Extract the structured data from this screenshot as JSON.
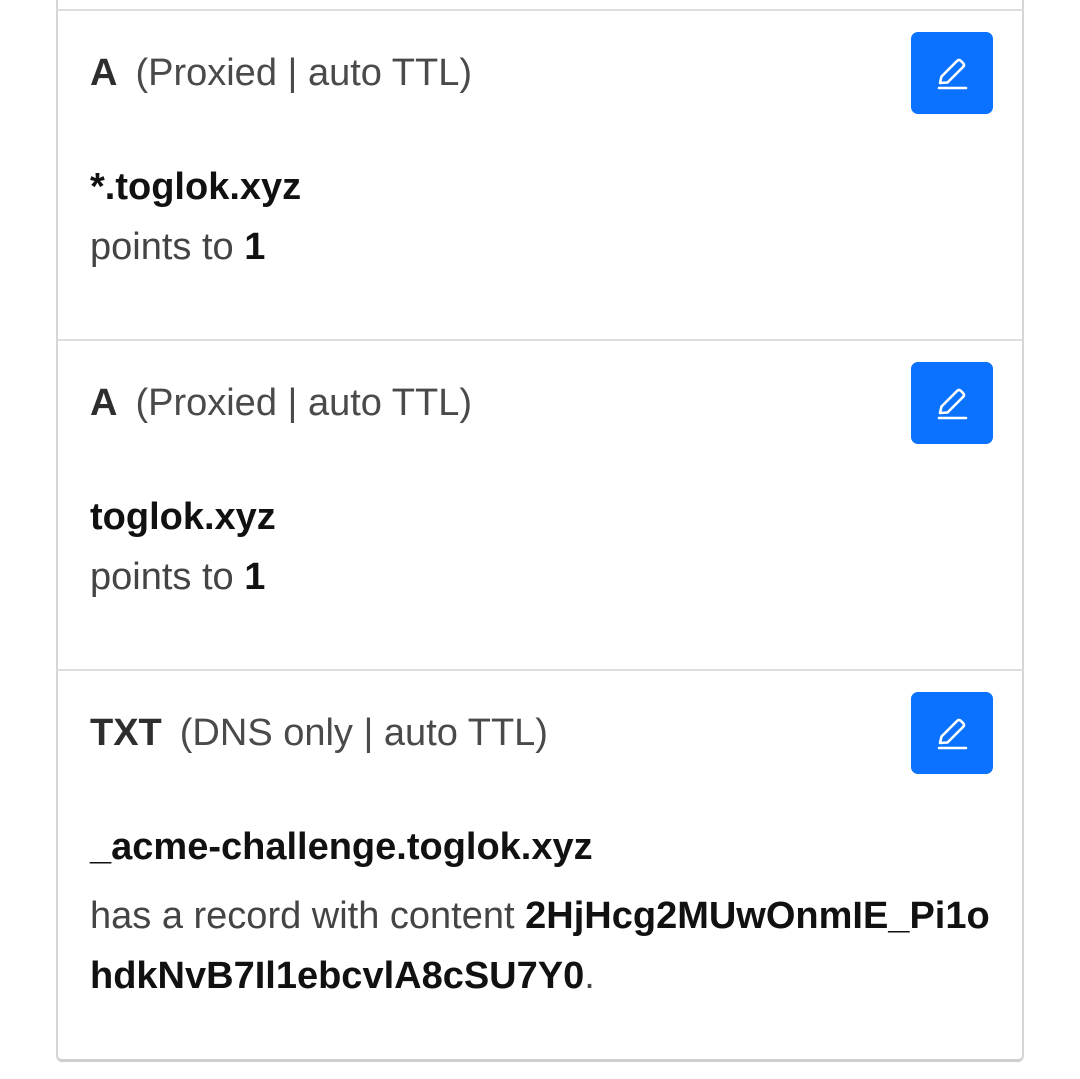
{
  "records": [
    {
      "type": "A",
      "meta": "(Proxied | auto TTL)",
      "name": "*.toglok.xyz",
      "detail_prefix": "points to",
      "detail_value": "1",
      "edit_icon": "pencil-icon"
    },
    {
      "type": "A",
      "meta": "(Proxied | auto TTL)",
      "name": "toglok.xyz",
      "detail_prefix": "points to",
      "detail_value": "1",
      "edit_icon": "pencil-icon"
    },
    {
      "type": "TXT",
      "meta": "(DNS only | auto TTL)",
      "name": "_acme-challenge.toglok.xyz",
      "detail_prefix": "has a record with content",
      "detail_value": "2HjHcg2MUwOnmIE_Pi1ohdkNvB7Il1ebcvlA8cSU7Y0",
      "detail_suffix": ".",
      "edit_icon": "pencil-icon"
    }
  ],
  "colors": {
    "edit_button": "#0a72ff",
    "border": "#dedede",
    "text_primary": "#111111",
    "text_secondary": "#444444"
  }
}
